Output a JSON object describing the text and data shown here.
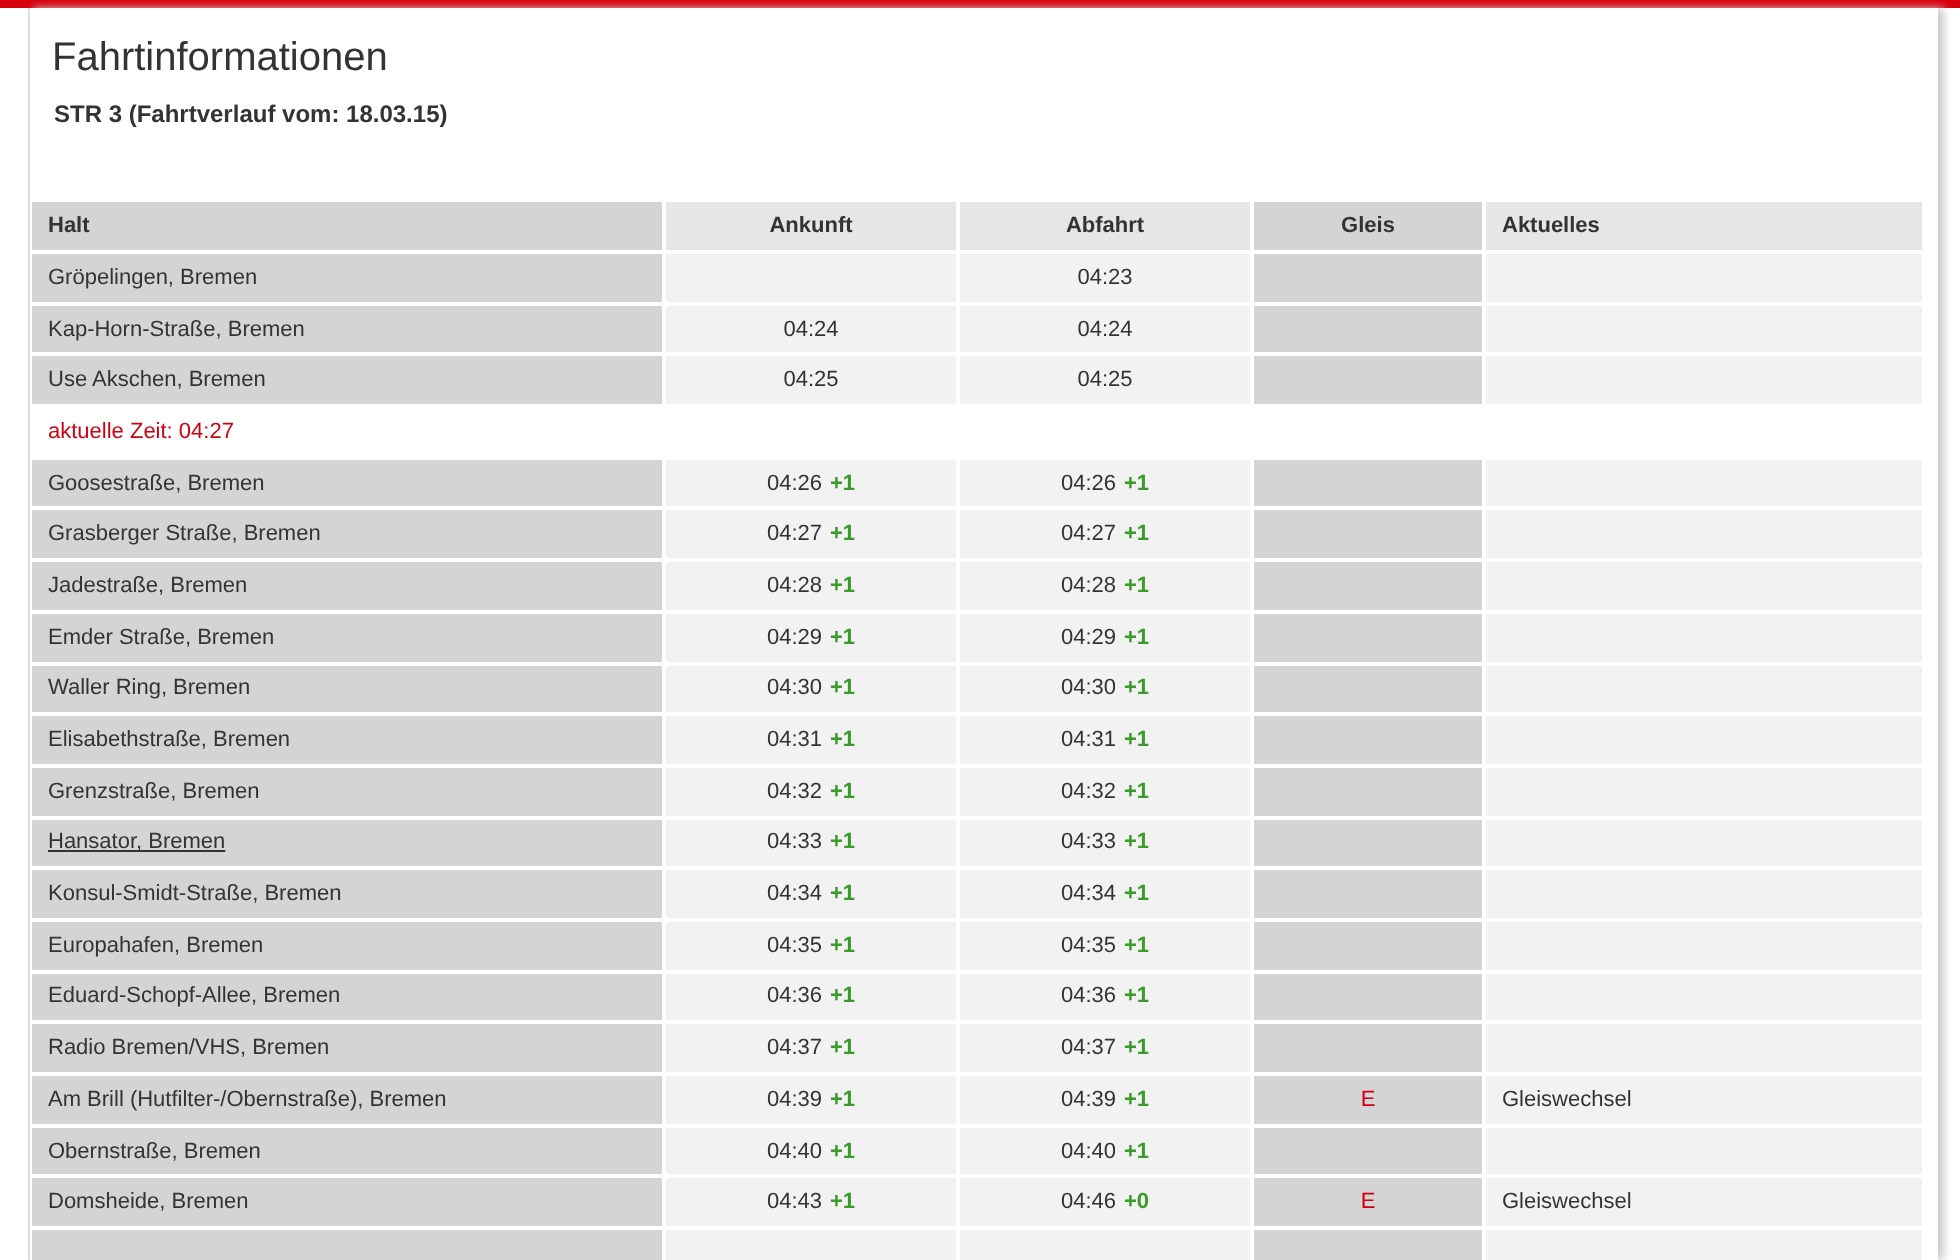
{
  "title": "Fahrtinformationen",
  "subtitle": "STR 3 (Fahrtverlauf vom: 18.03.15)",
  "columns": [
    "Halt",
    "Ankunft",
    "Abfahrt",
    "Gleis",
    "Aktuelles"
  ],
  "rows": [
    {
      "kind": "stop",
      "halt": "Gröpelingen, Bremen",
      "linked": false,
      "departure": {
        "time": "04:23"
      }
    },
    {
      "kind": "stop",
      "halt": "Kap-Horn-Straße, Bremen",
      "linked": false,
      "arrival": {
        "time": "04:24"
      },
      "departure": {
        "time": "04:24"
      }
    },
    {
      "kind": "stop",
      "halt": "Use Akschen, Bremen",
      "linked": false,
      "arrival": {
        "time": "04:25"
      },
      "departure": {
        "time": "04:25"
      }
    },
    {
      "kind": "notice",
      "text": "aktuelle Zeit: 04:27"
    },
    {
      "kind": "stop",
      "halt": "Goosestraße, Bremen",
      "linked": false,
      "arrival": {
        "time": "04:26",
        "delay": "+1"
      },
      "departure": {
        "time": "04:26",
        "delay": "+1"
      }
    },
    {
      "kind": "stop",
      "halt": "Grasberger Straße, Bremen",
      "linked": false,
      "arrival": {
        "time": "04:27",
        "delay": "+1"
      },
      "departure": {
        "time": "04:27",
        "delay": "+1"
      }
    },
    {
      "kind": "stop",
      "halt": "Jadestraße, Bremen",
      "linked": false,
      "arrival": {
        "time": "04:28",
        "delay": "+1"
      },
      "departure": {
        "time": "04:28",
        "delay": "+1"
      }
    },
    {
      "kind": "stop",
      "halt": "Emder Straße, Bremen",
      "linked": false,
      "arrival": {
        "time": "04:29",
        "delay": "+1"
      },
      "departure": {
        "time": "04:29",
        "delay": "+1"
      }
    },
    {
      "kind": "stop",
      "halt": "Waller Ring, Bremen",
      "linked": false,
      "arrival": {
        "time": "04:30",
        "delay": "+1"
      },
      "departure": {
        "time": "04:30",
        "delay": "+1"
      }
    },
    {
      "kind": "stop",
      "halt": "Elisabethstraße, Bremen",
      "linked": false,
      "arrival": {
        "time": "04:31",
        "delay": "+1"
      },
      "departure": {
        "time": "04:31",
        "delay": "+1"
      }
    },
    {
      "kind": "stop",
      "halt": "Grenzstraße, Bremen",
      "linked": false,
      "arrival": {
        "time": "04:32",
        "delay": "+1"
      },
      "departure": {
        "time": "04:32",
        "delay": "+1"
      }
    },
    {
      "kind": "stop",
      "halt": "Hansator, Bremen",
      "linked": true,
      "arrival": {
        "time": "04:33",
        "delay": "+1"
      },
      "departure": {
        "time": "04:33",
        "delay": "+1"
      }
    },
    {
      "kind": "stop",
      "halt": "Konsul-Smidt-Straße, Bremen",
      "linked": false,
      "arrival": {
        "time": "04:34",
        "delay": "+1"
      },
      "departure": {
        "time": "04:34",
        "delay": "+1"
      }
    },
    {
      "kind": "stop",
      "halt": "Europahafen, Bremen",
      "linked": false,
      "arrival": {
        "time": "04:35",
        "delay": "+1"
      },
      "departure": {
        "time": "04:35",
        "delay": "+1"
      }
    },
    {
      "kind": "stop",
      "halt": "Eduard-Schopf-Allee, Bremen",
      "linked": false,
      "arrival": {
        "time": "04:36",
        "delay": "+1"
      },
      "departure": {
        "time": "04:36",
        "delay": "+1"
      }
    },
    {
      "kind": "stop",
      "halt": "Radio Bremen/VHS, Bremen",
      "linked": false,
      "arrival": {
        "time": "04:37",
        "delay": "+1"
      },
      "departure": {
        "time": "04:37",
        "delay": "+1"
      }
    },
    {
      "kind": "stop",
      "halt": "Am Brill (Hutfilter-/Obernstraße), Bremen",
      "linked": false,
      "arrival": {
        "time": "04:39",
        "delay": "+1"
      },
      "departure": {
        "time": "04:39",
        "delay": "+1"
      },
      "gleis": "E",
      "note": "Gleiswechsel"
    },
    {
      "kind": "stop",
      "halt": "Obernstraße, Bremen",
      "linked": false,
      "arrival": {
        "time": "04:40",
        "delay": "+1"
      },
      "departure": {
        "time": "04:40",
        "delay": "+1"
      }
    },
    {
      "kind": "stop",
      "halt": "Domsheide, Bremen",
      "linked": false,
      "arrival": {
        "time": "04:43",
        "delay": "+1"
      },
      "departure": {
        "time": "04:46",
        "delay": "+0"
      },
      "gleis": "E",
      "note": "Gleiswechsel"
    },
    {
      "kind": "stop"
    }
  ]
}
